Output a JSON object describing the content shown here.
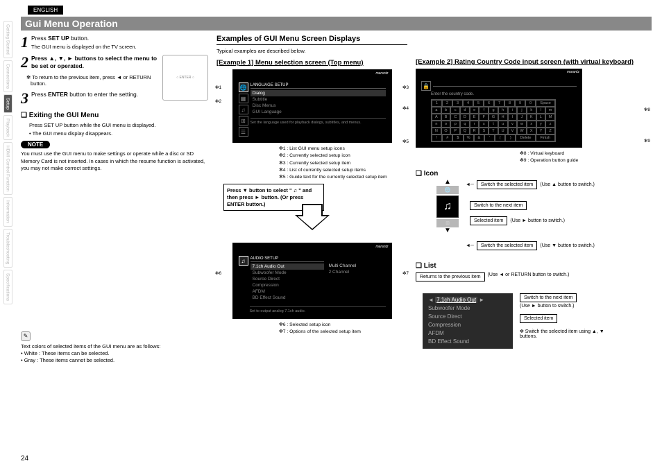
{
  "lang_tab": "ENGLISH",
  "title": "Gui Menu Operation",
  "side_tabs": [
    "Getting Started",
    "Connections",
    "Setup",
    "Playback",
    "HDMI Control Function",
    "Information",
    "Troubleshooting",
    "Specifications"
  ],
  "steps": [
    {
      "n": "1",
      "txt_pre": "Press ",
      "txt_bold": "SET UP",
      "txt_post": " button.",
      "sub": "The GUI menu is displayed on the TV screen."
    },
    {
      "n": "2",
      "txt_pre": "Press ▲, ▼, ► buttons to select the menu to be set or operated.",
      "note": "✻ To return to the previous item, press ◄ or RETURN button."
    },
    {
      "n": "3",
      "txt_pre": "Press ",
      "txt_bold": "ENTER",
      "txt_post": " button to enter the setting."
    }
  ],
  "exit_head": "Exiting the GUI Menu",
  "exit_line1": "Press SET UP button while the GUI menu is displayed.",
  "exit_line2": "• The GUI menu display disappears.",
  "note_label": "NOTE",
  "note_body": "You must use the GUI menu to make settings or operate while a disc or SD Memory Card is not inserted. In cases in which the resume function is activated, you may not make correct settings.",
  "colors_intro": "Text colors of selected items of the GUI menu are as follows:",
  "colors": [
    "• White : These items can be selected.",
    "• Gray : These items cannot be selected."
  ],
  "section_header": "Examples of GUI Menu Screen Displays",
  "section_sub": "Typical examples are described below.",
  "ex1_title": "[Example 1] Menu selection screen (Top menu)",
  "brand": "marantz",
  "screen1": {
    "title": "LANGUAGE SETUP",
    "items": [
      "Dialog",
      "Subtitle",
      "Disc Menus",
      "GUI Language"
    ],
    "guide": "Set the language used for playback dialogs, subtitles, and menus."
  },
  "callouts1": [
    "✻1",
    "✻2",
    "✻3",
    "✻4",
    "✻5"
  ],
  "legend1": [
    "✻1 : List GUI menu setup icons",
    "✻2 : Currently selected setup icon",
    "✻3 : Currently selected setup item",
    "✻4 : List of currently selected setup items",
    "✻5 : Guide text for the currently selected setup item"
  ],
  "action_box": "Press ▼ button to select \" ♫ \" and then press ► button.\n(Or press ENTER button.)",
  "screen2": {
    "title": "AUDIO SETUP",
    "items": [
      "7.1ch Audio Out",
      "Subwoofer Mode",
      "Source Direct",
      "Compression",
      "AFDM",
      "BD Effect Sound"
    ],
    "opts": [
      "Multi Channel",
      "2 Channel"
    ],
    "guide": "Set to output analog 7.1ch audio."
  },
  "callouts2": [
    "✻6",
    "✻7"
  ],
  "legend2": [
    "✻6 : Selected setup icon",
    "✻7 : Options of the selected setup item"
  ],
  "ex2_title": "[Example 2] Rating Country Code input screen (with virtual keyboard)",
  "kb": {
    "hint": "Enter the country code.",
    "rows": [
      [
        "1",
        "2",
        "3",
        "4",
        "5",
        "6",
        "7",
        "8",
        "9",
        "0",
        "Space"
      ],
      [
        "a",
        "b",
        "c",
        "d",
        "e",
        "f",
        "g",
        "h",
        "i",
        "j",
        "k",
        "l",
        "m"
      ],
      [
        "A",
        "B",
        "C",
        "D",
        "E",
        "F",
        "G",
        "H",
        "I",
        "J",
        "K",
        "L",
        "M"
      ],
      [
        "n",
        "o",
        "p",
        "q",
        "r",
        "s",
        "t",
        "u",
        "v",
        "w",
        "x",
        "y",
        "z"
      ],
      [
        "N",
        "O",
        "P",
        "Q",
        "R",
        "S",
        "T",
        "U",
        "V",
        "W",
        "X",
        "Y",
        "Z"
      ],
      [
        "!",
        "#",
        "$",
        "%",
        "&",
        "'",
        "(",
        ")",
        "Delete",
        "Finish"
      ]
    ]
  },
  "kb_callouts": [
    "✻8",
    "✻9"
  ],
  "kb_legend": [
    "✻8 : Virtual keyboard",
    "✻9 : Operation button guide"
  ],
  "icon_head": "Icon",
  "icon_diag": {
    "top": "Switch the selected item",
    "top_hint": "(Use ▲ button to switch.)",
    "next": "Switch to the next item",
    "sel": "Selected item",
    "sel_hint": "(Use ► button to switch.)",
    "bot": "Switch the selected item",
    "bot_hint": "(Use ▼ button to switch.)"
  },
  "list_head": "List",
  "list_diag": {
    "ret": "Returns to the previous item",
    "ret_hint": "(Use ◄ or RETURN button to switch.)",
    "next": "Switch to the next item",
    "next_hint": "(Use ► button to switch.)",
    "sel": "Selected item",
    "sw": "✻ Switch the selected item using ▲, ▼ buttons."
  },
  "list_items": [
    "7.1ch Audio Out",
    "Subwoofer Mode",
    "Source Direct",
    "Compression",
    "AFDM",
    "BD Effect Sound"
  ],
  "page": "24"
}
